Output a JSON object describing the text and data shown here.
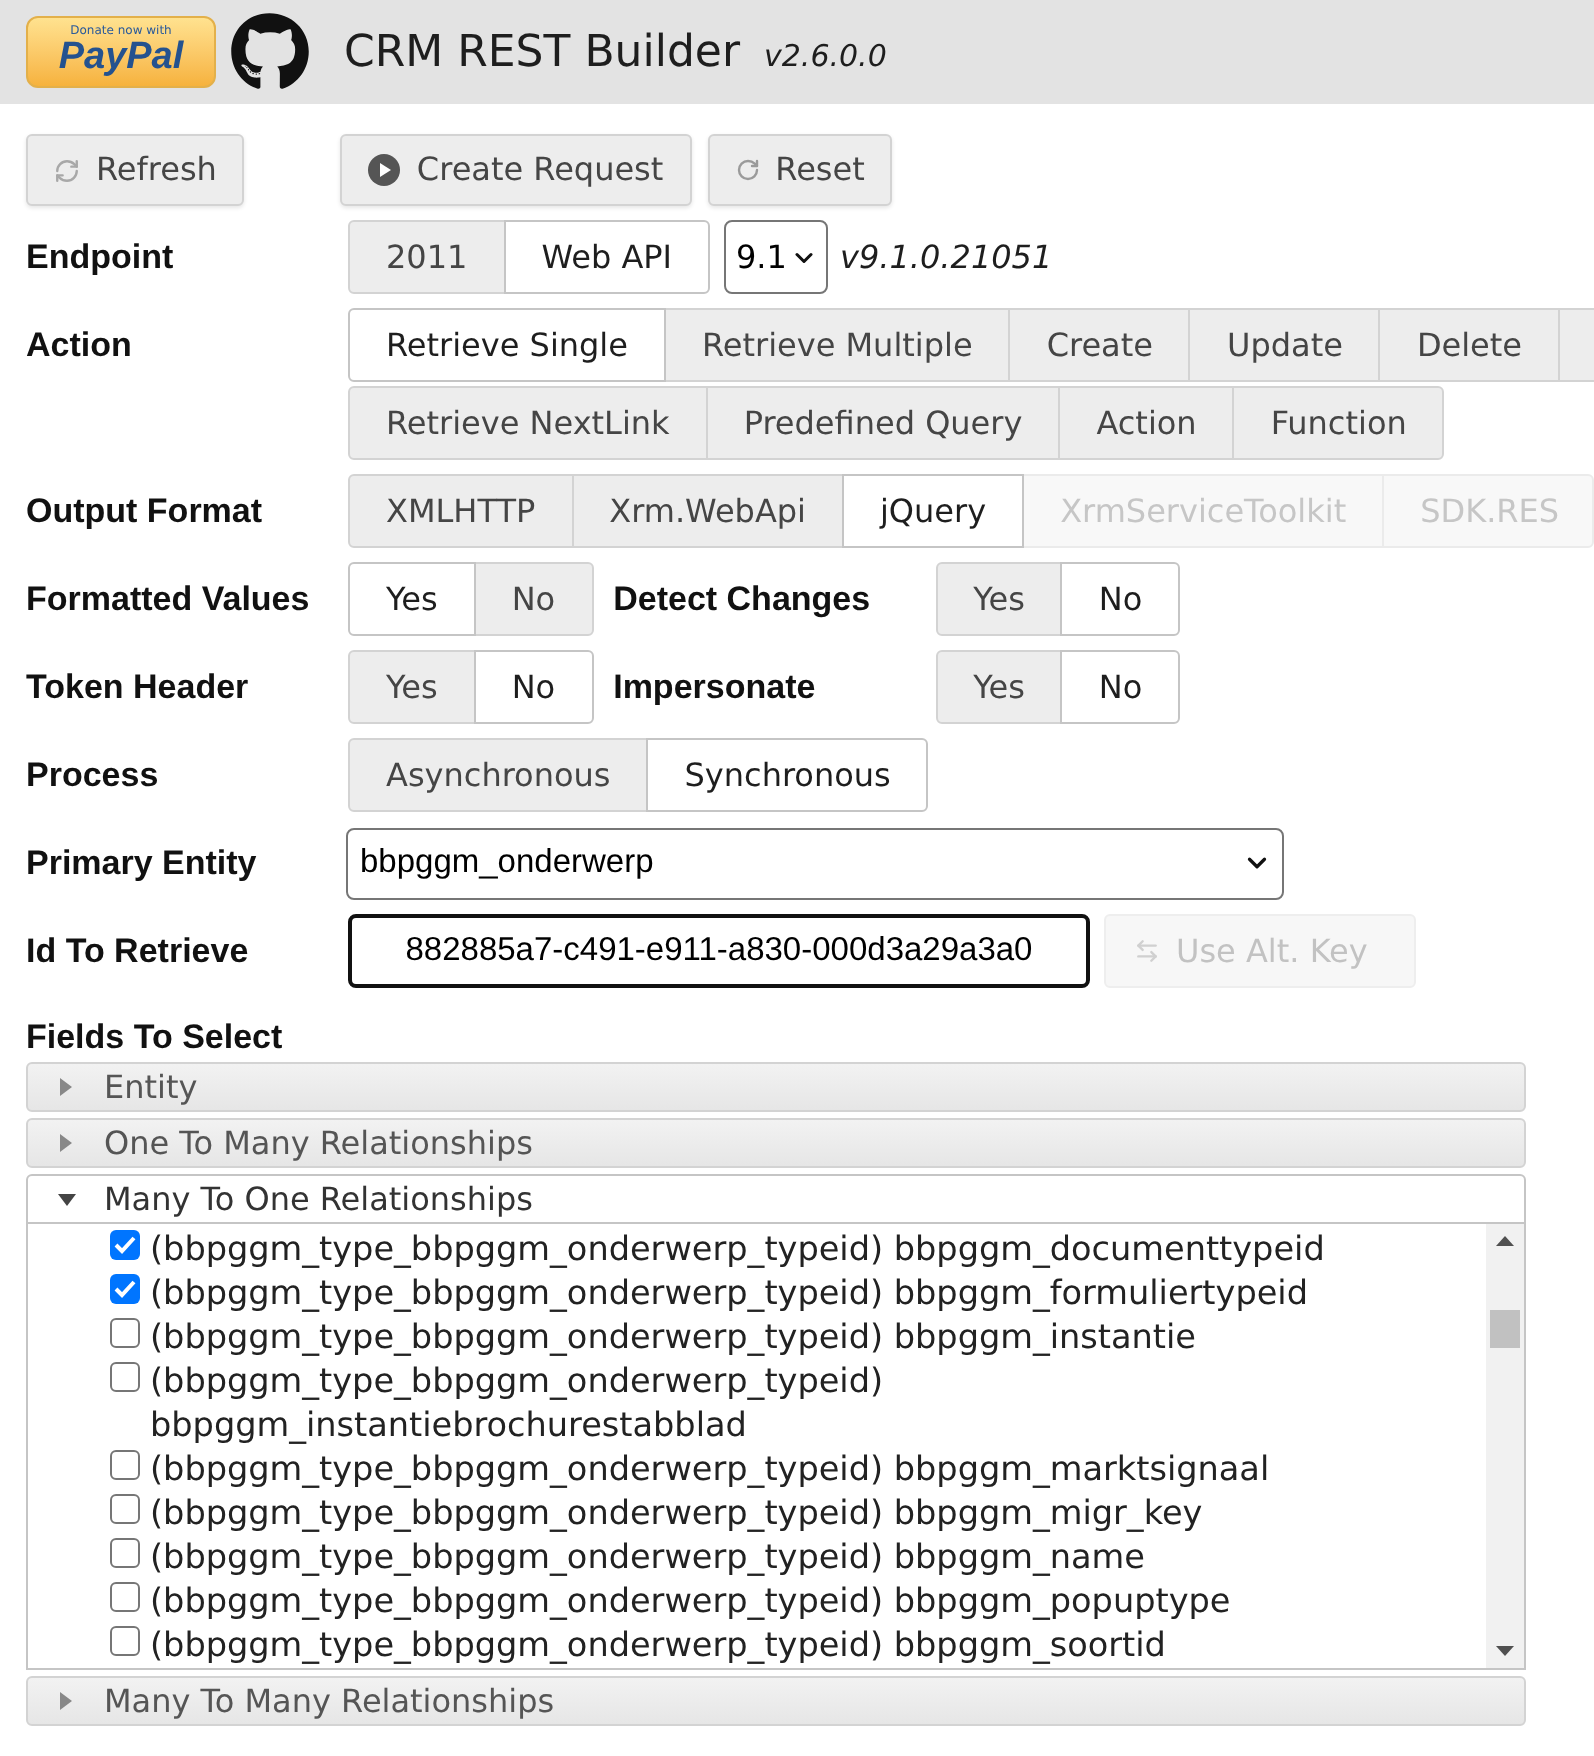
{
  "header": {
    "donate_button": {
      "caption": "Donate now with",
      "logo": "PayPal"
    },
    "title": "CRM REST Builder",
    "version": "v2.6.0.0"
  },
  "toolbar": [
    {
      "kind": "refresh",
      "label": "Refresh"
    },
    {
      "kind": "create",
      "label": "Create Request"
    },
    {
      "kind": "reset",
      "label": "Reset"
    }
  ],
  "endpoint": {
    "label": "Endpoint",
    "options": [
      {
        "label": "2011",
        "selected": false
      },
      {
        "label": "Web API",
        "selected": true
      }
    ],
    "version_select": "9.1",
    "version": "v9.1.0.21051"
  },
  "action": {
    "label": "Action",
    "rows": [
      [
        {
          "label": "Retrieve Single",
          "selected": true
        },
        {
          "label": "Retrieve Multiple",
          "selected": false
        },
        {
          "label": "Create",
          "selected": false
        },
        {
          "label": "Update",
          "selected": false
        },
        {
          "label": "Delete",
          "selected": false
        }
      ],
      [
        {
          "label": "Retrieve NextLink",
          "selected": false
        },
        {
          "label": "Predefined Query",
          "selected": false
        },
        {
          "label": "Action",
          "selected": false
        },
        {
          "label": "Function",
          "selected": false
        }
      ]
    ]
  },
  "output_format": {
    "label": "Output Format",
    "options": [
      {
        "label": "XMLHTTP",
        "selected": false,
        "disabled": false
      },
      {
        "label": "Xrm.WebApi",
        "selected": false,
        "disabled": false
      },
      {
        "label": "jQuery",
        "selected": true,
        "disabled": false
      },
      {
        "label": "XrmServiceToolkit",
        "selected": false,
        "disabled": true
      },
      {
        "label": "SDK.RES",
        "selected": false,
        "disabled": true
      }
    ]
  },
  "toggles": [
    [
      {
        "label": "Formatted Values",
        "options": [
          {
            "label": "Yes",
            "selected": true
          },
          {
            "label": "No",
            "selected": false
          }
        ]
      },
      {
        "label": "Detect Changes",
        "options": [
          {
            "label": "Yes",
            "selected": false
          },
          {
            "label": "No",
            "selected": true
          }
        ]
      }
    ],
    [
      {
        "label": "Token Header",
        "options": [
          {
            "label": "Yes",
            "selected": false
          },
          {
            "label": "No",
            "selected": true
          }
        ]
      },
      {
        "label": "Impersonate",
        "options": [
          {
            "label": "Yes",
            "selected": false
          },
          {
            "label": "No",
            "selected": true
          }
        ]
      }
    ]
  ],
  "process": {
    "label": "Process",
    "options": [
      {
        "label": "Asynchronous",
        "selected": false
      },
      {
        "label": "Synchronous",
        "selected": true
      }
    ]
  },
  "primary_entity": {
    "label": "Primary Entity",
    "value": "bbpggm_onderwerp"
  },
  "id_to_retrieve": {
    "label": "Id To Retrieve",
    "value": "882885a7-c491-e911-a830-000d3a29a3a0",
    "focused": true
  },
  "alt_key_button": {
    "label": "Use Alt. Key",
    "disabled": true
  },
  "fields_to_select": {
    "label": "Fields To Select",
    "sections": [
      {
        "title": "Entity",
        "expanded": false
      },
      {
        "title": "One To Many Relationships",
        "expanded": false
      },
      {
        "title": "Many To One Relationships",
        "expanded": true,
        "fields": [
          {
            "label": "(bbpggm_type_bbpggm_onderwerp_typeid) bbpggm_documenttypeid",
            "checked": true
          },
          {
            "label": "(bbpggm_type_bbpggm_onderwerp_typeid) bbpggm_formuliertypeid",
            "checked": true
          },
          {
            "label": "(bbpggm_type_bbpggm_onderwerp_typeid) bbpggm_instantie",
            "checked": false
          },
          {
            "label": "(bbpggm_type_bbpggm_onderwerp_typeid) bbpggm_instantiebrochurestabblad",
            "checked": false
          },
          {
            "label": "(bbpggm_type_bbpggm_onderwerp_typeid) bbpggm_marktsignaal",
            "checked": false
          },
          {
            "label": "(bbpggm_type_bbpggm_onderwerp_typeid) bbpggm_migr_key",
            "checked": false
          },
          {
            "label": "(bbpggm_type_bbpggm_onderwerp_typeid) bbpggm_name",
            "checked": false
          },
          {
            "label": "(bbpggm_type_bbpggm_onderwerp_typeid) bbpggm_popuptype",
            "checked": false
          },
          {
            "label": "(bbpggm_type_bbpggm_onderwerp_typeid) bbpggm_soortid",
            "checked": false
          }
        ]
      },
      {
        "title": "Many To Many Relationships",
        "expanded": false
      }
    ]
  }
}
